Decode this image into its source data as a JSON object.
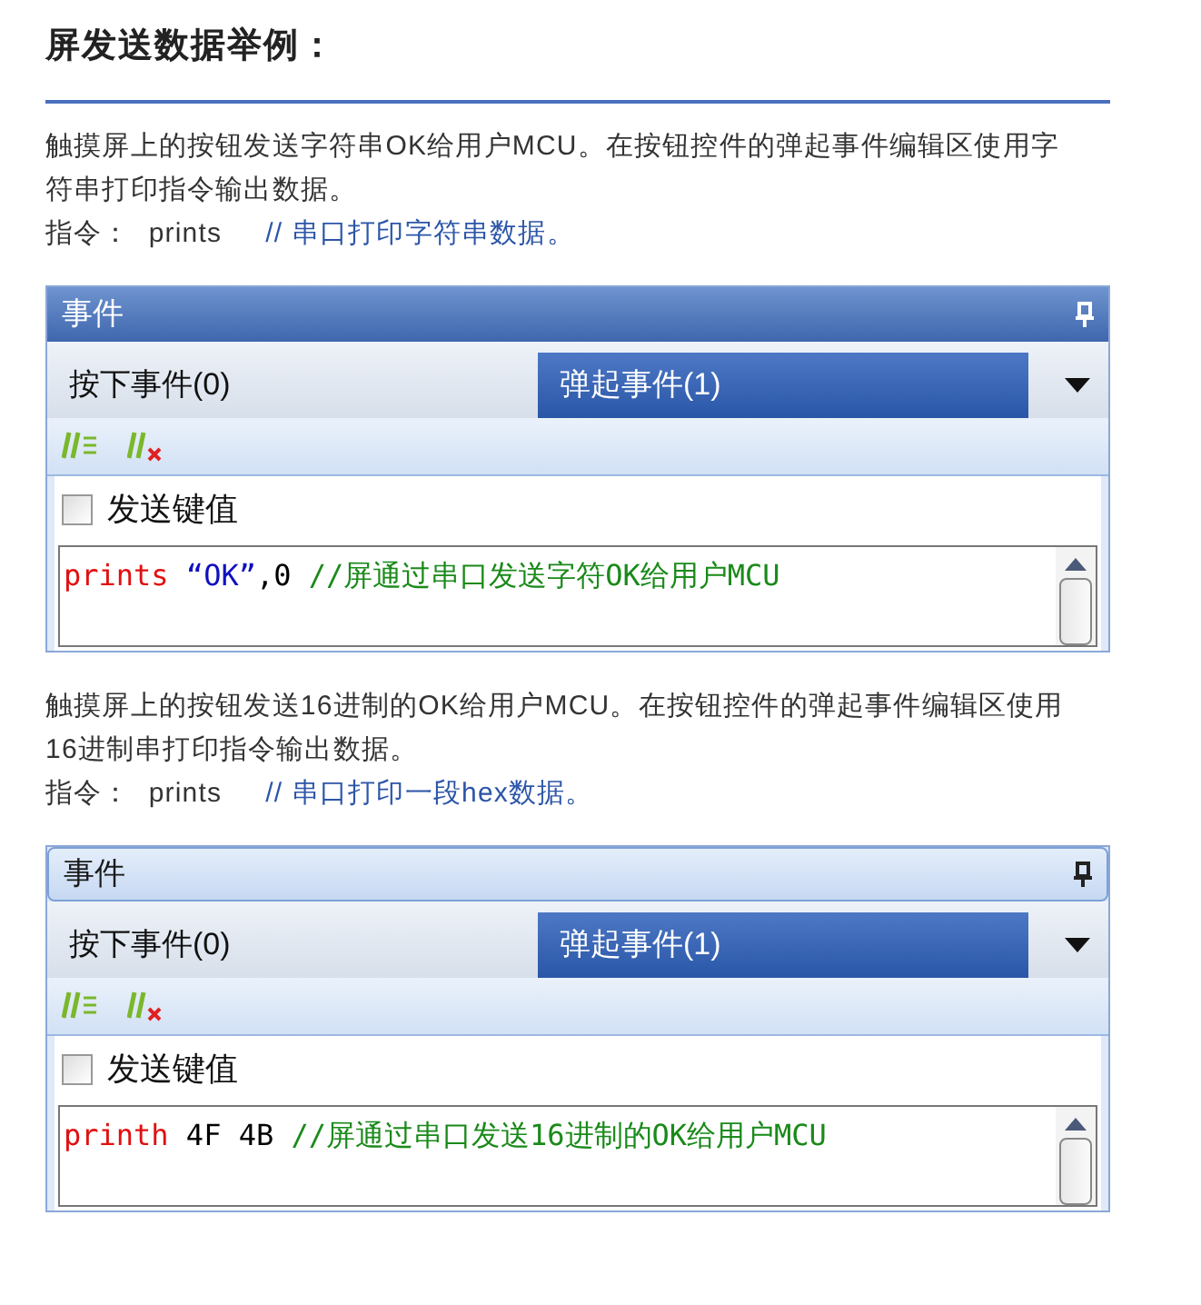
{
  "heading": "屏发送数据举例：",
  "examples": [
    {
      "description": "触摸屏上的按钮发送字符串OK给用户MCU。在按钮控件的弹起事件编辑区使用字符串打印指令输出数据。",
      "instruction_label": "指令：",
      "instruction": "prints",
      "instruction_comment": "// 串口打印字符串数据。",
      "panel": {
        "title": "事件",
        "focused": true,
        "tabs": [
          {
            "label": "按下事件(0)",
            "selected": false
          },
          {
            "label": "弹起事件(1)",
            "selected": true
          }
        ],
        "checkbox": {
          "label": "发送键值",
          "checked": false
        },
        "code": [
          {
            "kind": "keyword",
            "text": "prints"
          },
          {
            "kind": "string",
            "text": " “OK”"
          },
          {
            "kind": "plain",
            "text": ",0 "
          },
          {
            "kind": "comment",
            "text": "//屏通过串口发送字符OK给用户MCU"
          }
        ]
      }
    },
    {
      "description": "触摸屏上的按钮发送16进制的OK给用户MCU。在按钮控件的弹起事件编辑区使用16进制串打印指令输出数据。",
      "instruction_label": "指令：",
      "instruction": "prints",
      "instruction_comment": "// 串口打印一段hex数据。",
      "panel": {
        "title": "事件",
        "focused": false,
        "tabs": [
          {
            "label": "按下事件(0)",
            "selected": false
          },
          {
            "label": "弹起事件(1)",
            "selected": true
          }
        ],
        "checkbox": {
          "label": "发送键值",
          "checked": false
        },
        "code": [
          {
            "kind": "keyword",
            "text": "printh"
          },
          {
            "kind": "plain",
            "text": " 4F 4B "
          },
          {
            "kind": "comment",
            "text": "//屏通过串口发送16进制的OK给用户MCU"
          }
        ]
      }
    }
  ]
}
